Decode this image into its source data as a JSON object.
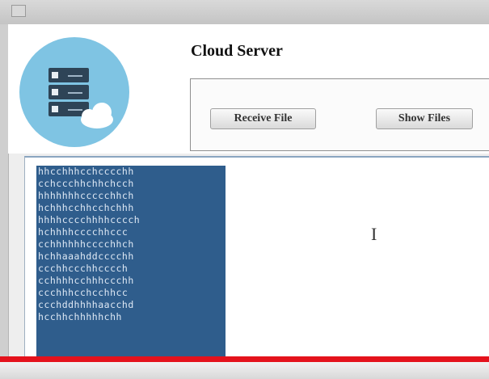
{
  "app": {
    "title": "Cloud Server"
  },
  "buttons": {
    "receive": "Receive File",
    "show": "Show Files"
  },
  "output": {
    "lines": [
      "hhcchhhcchcccchh",
      "cchccchhchhchcch",
      "hhhhhhhccccchhch",
      "hchhhcchhcchchhh",
      "hhhhcccchhhhcccch",
      "hchhhhcccchhccc",
      "cchhhhhhcccchhch",
      "hchhaaahddcccchh",
      "ccchhccchhcccch",
      "cchhhhcchhhccchh",
      "ccchhhcchcchhcc",
      "ccchddhhhhaacchd",
      "hcchhchhhhhchh"
    ]
  },
  "colors": {
    "selection": "#2f5d8c",
    "logo_circle": "#7fc4e3",
    "red_line": "#e4121c"
  }
}
